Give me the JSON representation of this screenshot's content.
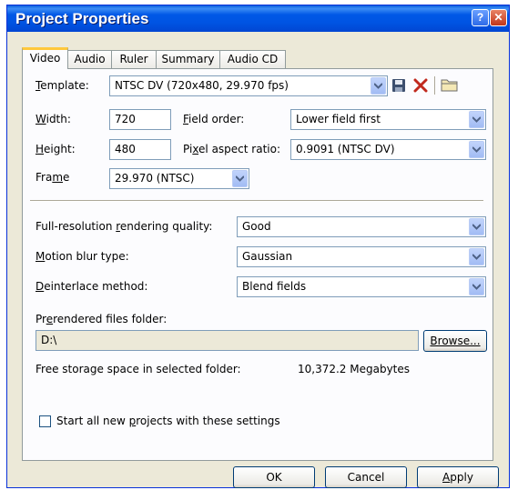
{
  "window": {
    "title": "Project Properties",
    "help_symbol": "?",
    "close_symbol": "✕"
  },
  "tabs": [
    {
      "label": "Video",
      "active": true
    },
    {
      "label": "Audio",
      "active": false
    },
    {
      "label": "Ruler",
      "active": false
    },
    {
      "label": "Summary",
      "active": false
    },
    {
      "label": "Audio CD",
      "active": false
    }
  ],
  "template": {
    "label": "Template:",
    "value": "NTSC DV (720x480, 29.970 fps)",
    "icons": [
      "save-icon",
      "delete-icon",
      "folder-icon"
    ],
    "delete_color": "#C0281C"
  },
  "width": {
    "label": "Width:",
    "value": "720"
  },
  "height": {
    "label": "Height:",
    "value": "480"
  },
  "field_order": {
    "label": "Field order:",
    "value": "Lower field first"
  },
  "pixel_aspect": {
    "label": "Pixel aspect ratio:",
    "value": "0.9091 (NTSC DV)"
  },
  "frame": {
    "label": "Frame",
    "value": "29.970 (NTSC)"
  },
  "render_quality": {
    "label": "Full-resolution rendering quality:",
    "value": "Good"
  },
  "motion_blur": {
    "label": "Motion blur type:",
    "value": "Gaussian"
  },
  "deinterlace": {
    "label": "Deinterlace method:",
    "value": "Blend fields"
  },
  "prerender": {
    "label": "Prerendered files folder:",
    "path": "D:\\",
    "browse_label": "Browse...",
    "free_space_label": "Free storage space in selected folder:",
    "free_space_value": "10,372.2 Megabytes"
  },
  "default_checkbox": {
    "label": "Start all new projects with these settings",
    "checked": false
  },
  "buttons": {
    "ok": "OK",
    "cancel": "Cancel",
    "apply": "Apply"
  },
  "colors": {
    "titlebar": "#0054E3",
    "dialog_bg": "#ECE9D8",
    "tab_highlight": "#FFC83C"
  }
}
